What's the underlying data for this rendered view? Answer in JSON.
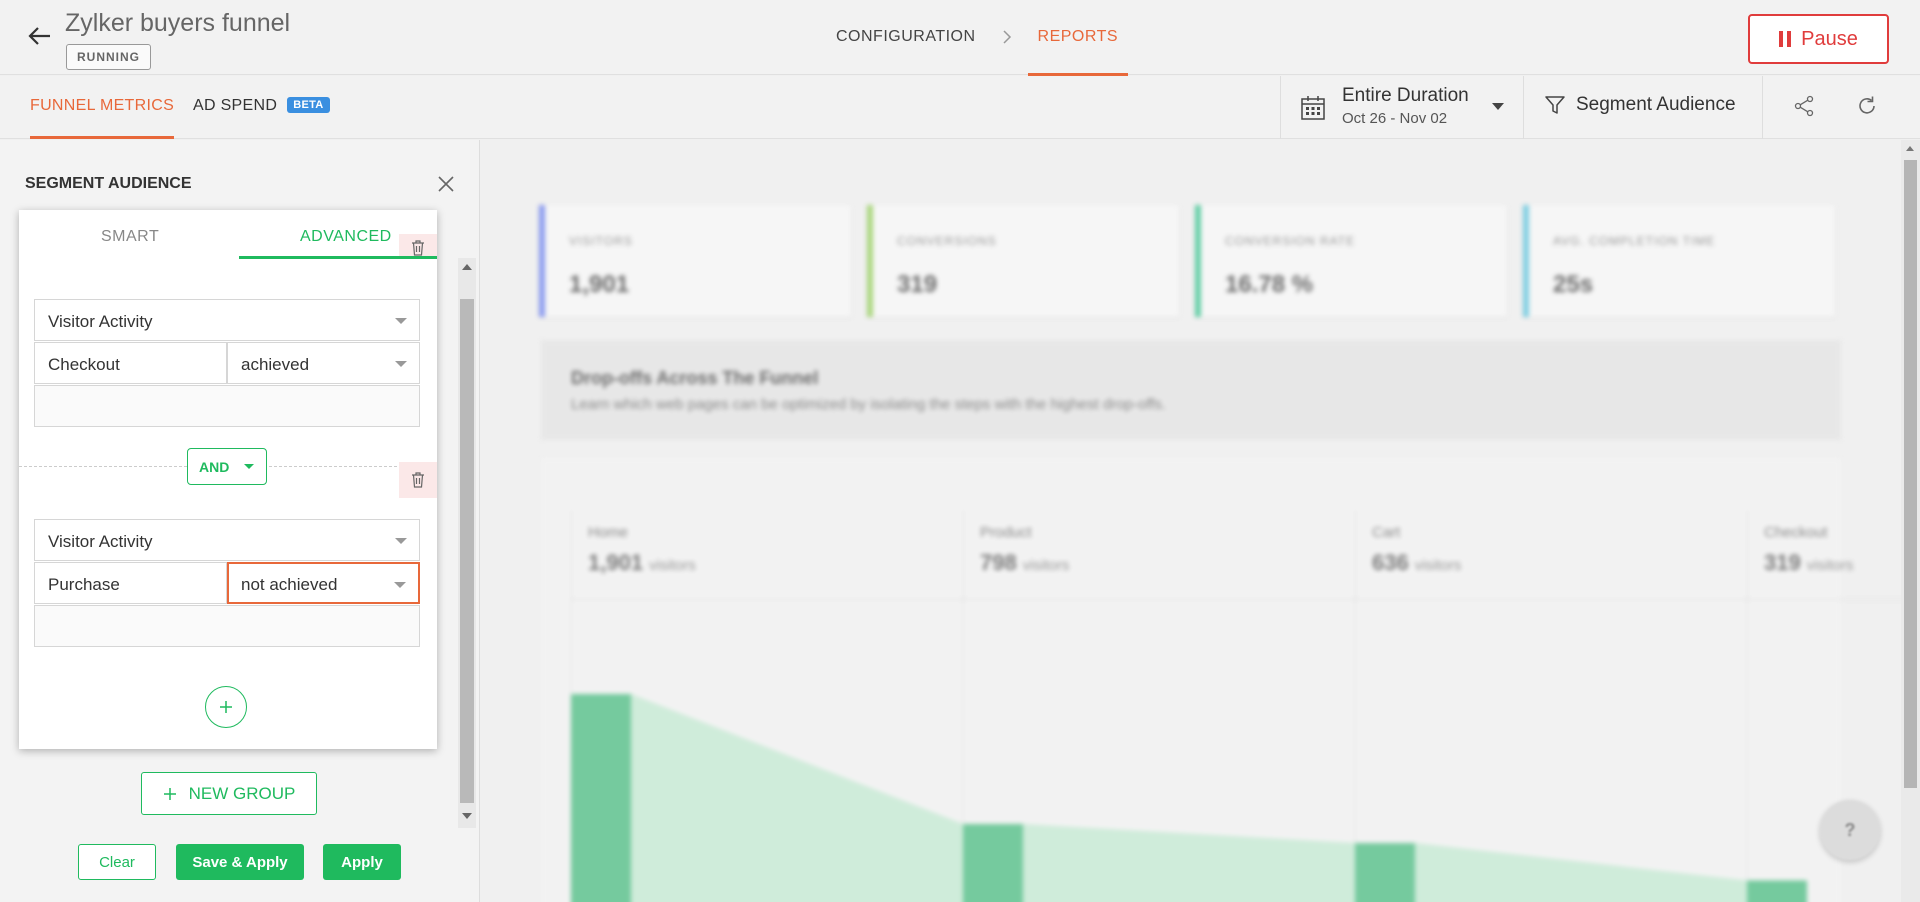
{
  "header": {
    "title": "Zylker buyers funnel",
    "status": "RUNNING",
    "breadcrumbs": [
      "CONFIGURATION",
      "REPORTS"
    ],
    "pause_label": "Pause"
  },
  "subnav": {
    "tabs": [
      {
        "label": "FUNNEL METRICS"
      },
      {
        "label": "AD SPEND",
        "badge": "BETA"
      }
    ],
    "duration_title": "Entire Duration",
    "duration_range": "Oct 26 - Nov 02",
    "segment_label": "Segment Audience"
  },
  "segment_panel": {
    "title": "SEGMENT AUDIENCE",
    "tabs": [
      "SMART",
      "ADVANCED"
    ],
    "conditions": [
      {
        "type": "Visitor Activity",
        "goal": "Checkout",
        "operator": "achieved",
        "value": ""
      },
      {
        "type": "Visitor Activity",
        "goal": "Purchase",
        "operator": "not achieved",
        "value": ""
      }
    ],
    "join_operator": "AND",
    "new_group_label": "NEW GROUP",
    "buttons": {
      "clear": "Clear",
      "save_apply": "Save & Apply",
      "apply": "Apply"
    }
  },
  "metrics": [
    {
      "label": "VISITORS",
      "value": "1,901",
      "color": "#7b8ef0"
    },
    {
      "label": "CONVERSIONS",
      "value": "319",
      "color": "#9fd36b"
    },
    {
      "label": "CONVERSION RATE",
      "value": "16.78 %",
      "color": "#4cc99a"
    },
    {
      "label": "AVG. COMPLETION TIME",
      "value": "25s",
      "color": "#6cc9e0"
    }
  ],
  "dropoff": {
    "heading": "Drop-offs Across The Funnel",
    "subtext": "Learn which web pages can be optimized by isolating the steps with the highest drop-offs."
  },
  "funnel_unit": "visitors",
  "chart_data": {
    "type": "bar",
    "categories": [
      "Home",
      "Product",
      "Cart",
      "Checkout"
    ],
    "values": [
      1901,
      798,
      636,
      319
    ],
    "ylim": [
      0,
      1901
    ]
  },
  "colors": {
    "accent": "#e8683a",
    "green": "#1fba5e",
    "danger": "#e03c3c"
  }
}
